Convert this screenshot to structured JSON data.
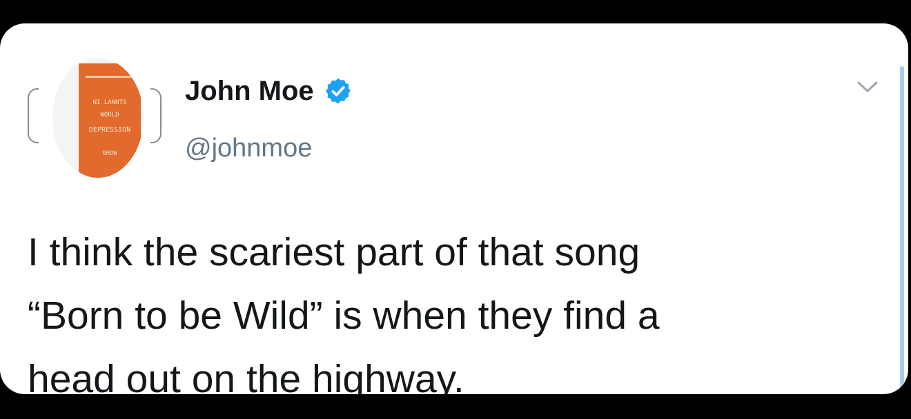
{
  "tweet": {
    "author": {
      "display_name": "John Moe",
      "handle": "@johnmoe",
      "verified": true,
      "avatar": {
        "icon": "book-cover-avatar",
        "cover_color": "#e26a2c",
        "cover_text_lines": [
          "NI LANNTS",
          "WORLD",
          "DEPRESSION",
          "SHOW"
        ]
      }
    },
    "menu_icon": "chevron-down-icon",
    "text_lines": [
      "I think the scariest part of that song",
      "“Born to be Wild” is when they find a",
      "head out on the highway."
    ]
  },
  "colors": {
    "background": "#000000",
    "card": "#ffffff",
    "text": "#14171a",
    "handle": "#657786",
    "verified_badge": "#1da1f2"
  }
}
